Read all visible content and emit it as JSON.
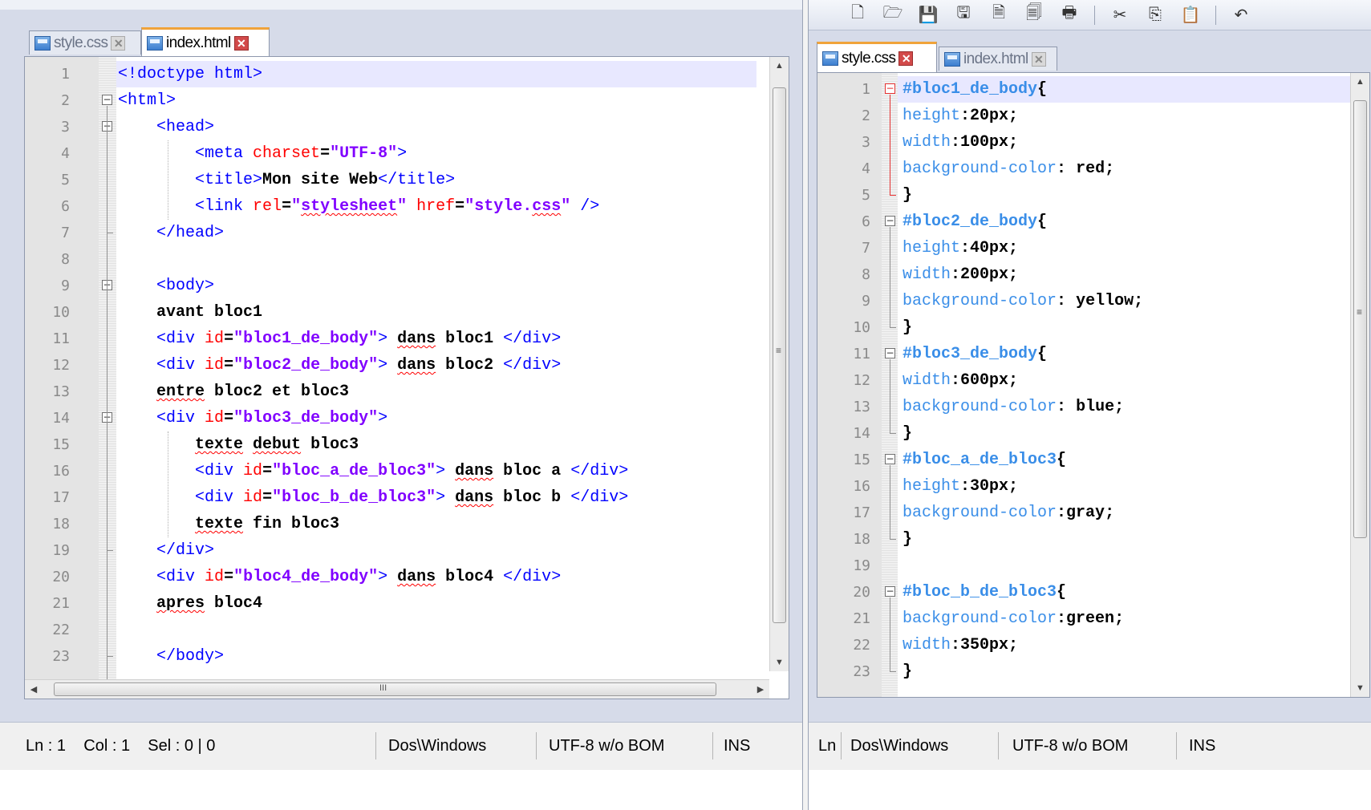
{
  "toolbar": {
    "icons": [
      "new-file-icon",
      "open-folder-icon",
      "save-icon",
      "save-all-icon",
      "close-file-icon",
      "close-all-icon",
      "print-icon",
      "cut-icon",
      "copy-icon",
      "paste-icon",
      "undo-icon"
    ]
  },
  "left": {
    "tabs": [
      {
        "label": "style.css",
        "active": false
      },
      {
        "label": "index.html",
        "active": true
      }
    ],
    "lines": [
      {
        "n": "1",
        "c": "<!doctype html>"
      },
      {
        "n": "2",
        "c": "<html>"
      },
      {
        "n": "3",
        "c": "    <head>"
      },
      {
        "n": "4",
        "c": "        <meta charset=\"UTF-8\">"
      },
      {
        "n": "5",
        "c": "        <title>Mon site Web</title>"
      },
      {
        "n": "6",
        "c": "        <link rel=\"stylesheet\" href=\"style.css\" />"
      },
      {
        "n": "7",
        "c": "    </head>"
      },
      {
        "n": "8",
        "c": ""
      },
      {
        "n": "9",
        "c": "    <body>"
      },
      {
        "n": "10",
        "c": "    avant bloc1"
      },
      {
        "n": "11",
        "c": "    <div id=\"bloc1_de_body\"> dans bloc1 </div>"
      },
      {
        "n": "12",
        "c": "    <div id=\"bloc2_de_body\"> dans bloc2 </div>"
      },
      {
        "n": "13",
        "c": "    entre bloc2 et bloc3"
      },
      {
        "n": "14",
        "c": "    <div id=\"bloc3_de_body\">"
      },
      {
        "n": "15",
        "c": "        texte debut bloc3"
      },
      {
        "n": "16",
        "c": "        <div id=\"bloc_a_de_bloc3\"> dans bloc a </div>"
      },
      {
        "n": "17",
        "c": "        <div id=\"bloc_b_de_bloc3\"> dans bloc b </div>"
      },
      {
        "n": "18",
        "c": "        texte fin bloc3"
      },
      {
        "n": "19",
        "c": "    </div>"
      },
      {
        "n": "20",
        "c": "    <div id=\"bloc4_de_body\"> dans bloc4 </div>"
      },
      {
        "n": "21",
        "c": "    apres bloc4"
      },
      {
        "n": "22",
        "c": ""
      },
      {
        "n": "23",
        "c": "    </body>"
      }
    ],
    "status": {
      "position": "Ln : 1    Col : 1    Sel : 0 | 0",
      "eol": "Dos\\Windows",
      "encoding": "UTF-8 w/o BOM",
      "mode": "INS"
    },
    "hscroll_glyph": "III"
  },
  "right": {
    "tabs": [
      {
        "label": "style.css",
        "active": true
      },
      {
        "label": "index.html",
        "active": false
      }
    ],
    "lines": [
      {
        "n": "1",
        "c": "#bloc1_de_body{"
      },
      {
        "n": "2",
        "c": "height:20px;"
      },
      {
        "n": "3",
        "c": "width:100px;"
      },
      {
        "n": "4",
        "c": "background-color: red;"
      },
      {
        "n": "5",
        "c": "}"
      },
      {
        "n": "6",
        "c": "#bloc2_de_body{"
      },
      {
        "n": "7",
        "c": "height:40px;"
      },
      {
        "n": "8",
        "c": "width:200px;"
      },
      {
        "n": "9",
        "c": "background-color: yellow;"
      },
      {
        "n": "10",
        "c": "}"
      },
      {
        "n": "11",
        "c": "#bloc3_de_body{"
      },
      {
        "n": "12",
        "c": "width:600px;"
      },
      {
        "n": "13",
        "c": "background-color: blue;"
      },
      {
        "n": "14",
        "c": "}"
      },
      {
        "n": "15",
        "c": "#bloc_a_de_bloc3{"
      },
      {
        "n": "16",
        "c": "height:30px;"
      },
      {
        "n": "17",
        "c": "background-color:gray;"
      },
      {
        "n": "18",
        "c": "}"
      },
      {
        "n": "19",
        "c": ""
      },
      {
        "n": "20",
        "c": "#bloc_b_de_bloc3{"
      },
      {
        "n": "21",
        "c": "background-color:green;"
      },
      {
        "n": "22",
        "c": "width:350px;"
      },
      {
        "n": "23",
        "c": "}"
      }
    ],
    "status": {
      "position": "Ln",
      "eol": "Dos\\Windows",
      "encoding": "UTF-8 w/o BOM",
      "mode": "INS"
    }
  },
  "colors": {
    "tag": "#0000ff",
    "attribute": "#ff0000",
    "value": "#8000ff",
    "css_property": "#3a8ee8",
    "active_tab_accent": "#f0a33a",
    "current_line": "#e8e8ff"
  }
}
